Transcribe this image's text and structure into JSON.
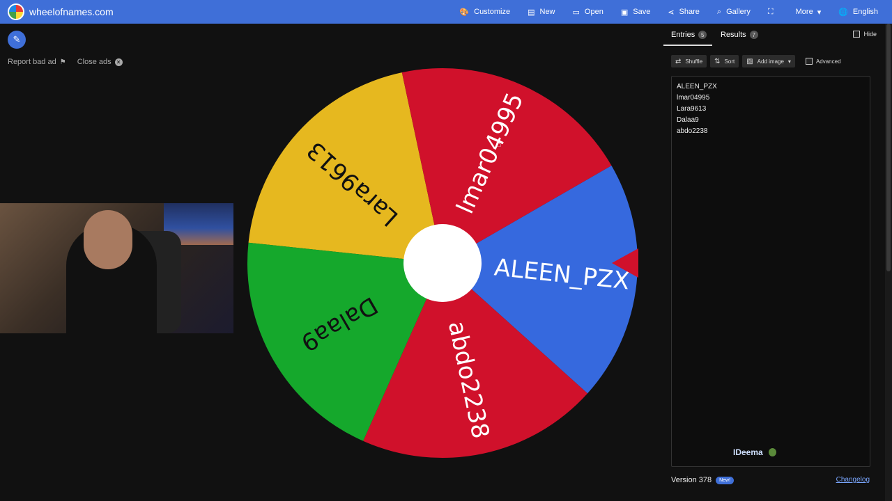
{
  "site": {
    "name": "wheelofnames.com"
  },
  "menu": [
    {
      "label": "Customize",
      "icon": "palette-icon"
    },
    {
      "label": "New",
      "icon": "file-icon"
    },
    {
      "label": "Open",
      "icon": "folder-icon"
    },
    {
      "label": "Save",
      "icon": "save-icon"
    },
    {
      "label": "Share",
      "icon": "share-icon"
    },
    {
      "label": "Gallery",
      "icon": "search-icon"
    },
    {
      "label": "",
      "icon": "fullscreen-icon"
    },
    {
      "label": "More",
      "icon": "chevron-down-icon"
    },
    {
      "label": "English",
      "icon": "globe-icon"
    }
  ],
  "ads": {
    "report": "Report bad ad",
    "close": "Close ads"
  },
  "wheel": {
    "segments": [
      {
        "label": "Lara9613",
        "color": "#e6b81f"
      },
      {
        "label": "lmar04995",
        "color": "#d0112b"
      },
      {
        "label": "ALEEN_PZX",
        "color": "#3669de"
      },
      {
        "label": "abdo2238",
        "color": "#d0112b"
      },
      {
        "label": "Dalaa9",
        "color": "#15a82c"
      }
    ],
    "pointer_color": "#d0112b"
  },
  "panel": {
    "tabs": {
      "entries": {
        "label": "Entries",
        "count": "5"
      },
      "results": {
        "label": "Results",
        "count": "7"
      }
    },
    "hide_label": "Hide",
    "toolbar": {
      "shuffle": "Shuffle",
      "sort": "Sort",
      "add_image": "Add image",
      "advanced": "Advanced"
    },
    "entries": [
      "ALEEN_PZX",
      "lmar04995",
      "Lara9613",
      "Dalaa9",
      "abdo2238"
    ],
    "brand": "IDeema",
    "version": "Version 378",
    "new_badge": "New!",
    "changelog": "Changelog"
  }
}
